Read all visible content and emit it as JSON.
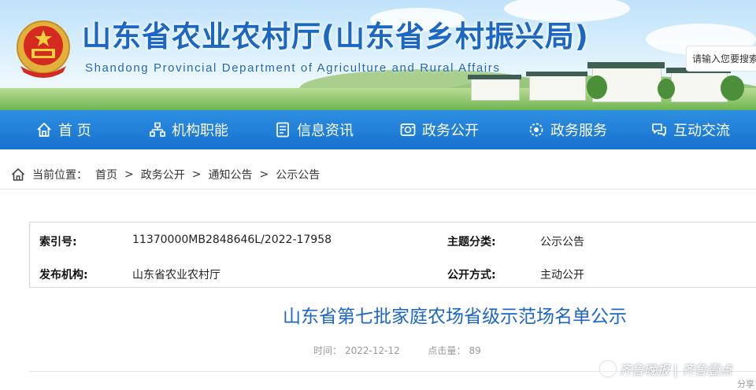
{
  "header": {
    "title": "山东省农业农村厅(山东省乡村振兴局)",
    "subtitle": "Shandong Provincial Department of Agriculture and Rural Affairs",
    "search_placeholder": "请输入您要搜索"
  },
  "nav": {
    "items": [
      {
        "label": "首 页",
        "icon": "home-icon"
      },
      {
        "label": "机构职能",
        "icon": "org-chart-icon"
      },
      {
        "label": "信息资讯",
        "icon": "document-icon"
      },
      {
        "label": "政务公开",
        "icon": "public-affairs-icon"
      },
      {
        "label": "政务服务",
        "icon": "service-icon"
      },
      {
        "label": "互动交流",
        "icon": "chat-icon"
      }
    ]
  },
  "breadcrumb": {
    "prefix": "当前位置：",
    "items": [
      "首页",
      "政务公开",
      "通知公告",
      "公示公告"
    ],
    "separator": ">"
  },
  "meta": {
    "index_label": "索引号:",
    "index_value": "11370000MB2848646L/2022-17958",
    "category_label": "主题分类:",
    "category_value": "公示公告",
    "publisher_label": "发布机构:",
    "publisher_value": "山东省农业农村厅",
    "disclosure_label": "公开方式:",
    "disclosure_value": "主动公开"
  },
  "article": {
    "title": "山东省第七批家庭农场省级示范场名单公示",
    "time_label": "时间：",
    "time_value": "2022-12-12",
    "clicks_label": "点击量：",
    "clicks_value": "89"
  },
  "watermark": {
    "text": "齐鲁晚报 | 齐鲁壹点"
  },
  "share_fragment": "分享",
  "colors": {
    "brand_blue": "#1c66c4",
    "nav_blue": "#1772cf",
    "muted_gray": "#9a9a9a"
  }
}
